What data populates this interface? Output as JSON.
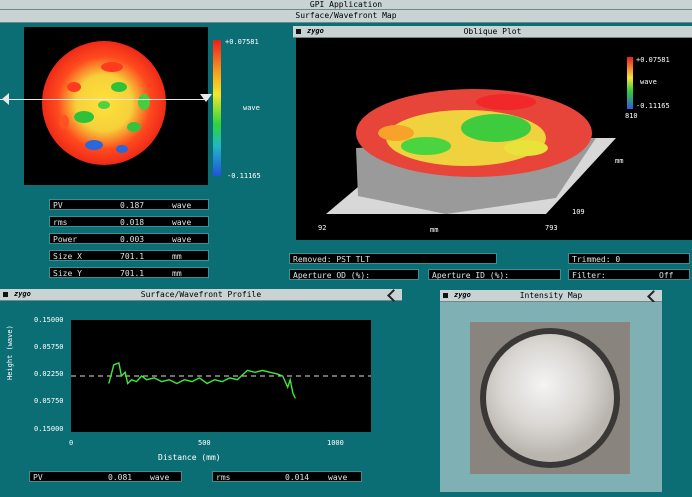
{
  "app": {
    "title": "GPI Application",
    "subtitle": "Surface/Wavefront Map"
  },
  "map": {
    "colorbar_max": "+0.07581",
    "colorbar_min": "-0.11165",
    "colorbar_unit": "wave"
  },
  "oblique": {
    "logo": "zygo",
    "title": "Oblique Plot",
    "colorbar_max": "+0.07581",
    "colorbar_unit": "wave",
    "colorbar_min": "-0.11165",
    "z_tick": "810",
    "x_start": "92",
    "x_unit": "mm",
    "x_end": "793",
    "y_unit": "mm",
    "y_start": "109"
  },
  "stats": [
    {
      "label": "PV",
      "value": "0.187",
      "unit": "wave"
    },
    {
      "label": "rms",
      "value": "0.018",
      "unit": "wave"
    },
    {
      "label": "Power",
      "value": "0.003",
      "unit": "wave"
    },
    {
      "label": "Size X",
      "value": "701.1",
      "unit": "mm"
    },
    {
      "label": "Size Y",
      "value": "701.1",
      "unit": "mm"
    }
  ],
  "status": {
    "removed": "Removed: PST TLT",
    "trimmed": "Trimmed: 0",
    "aperture_od": "Aperture OD (%):",
    "aperture_id": "Aperture ID (%):",
    "filter": "Filter:",
    "filter_value": "Off"
  },
  "profile": {
    "logo": "zygo",
    "title": "Surface/Wavefront Profile",
    "ylabel": "Height (wave)",
    "xlabel": "Distance (mm)",
    "yticks": [
      "0.15000",
      "0.05750",
      "0.02250",
      "0.05750",
      "0.15000"
    ],
    "xticks": [
      "0",
      "500",
      "1000"
    ],
    "pv_label": "PV",
    "pv_value": "0.081",
    "pv_unit": "wave",
    "rms_label": "rms",
    "rms_value": "0.014",
    "rms_unit": "wave"
  },
  "intensity": {
    "logo": "zygo",
    "title": "Intensity Map"
  },
  "colors": {
    "background": "#0b6e74",
    "titlebar": "#c9d3d4",
    "trace": "#41e83a"
  },
  "chart_data": {
    "type": "line",
    "xlabel": "Distance (mm)",
    "ylabel": "Height (wave)",
    "xlim": [
      0,
      1000
    ],
    "ylim": [
      -0.15,
      0.15
    ],
    "series": [
      {
        "x": [
          150,
          170,
          190,
          200,
          215,
          225,
          240,
          260,
          280,
          300,
          330,
          360,
          390,
          420,
          450,
          480,
          510,
          540,
          570,
          600,
          630,
          660,
          700,
          730,
          760,
          790,
          820,
          840,
          860,
          870,
          880,
          890
        ],
        "values": [
          -0.02,
          0.03,
          0.035,
          0.0,
          0.01,
          -0.02,
          -0.01,
          -0.015,
          0.0,
          -0.01,
          -0.005,
          -0.015,
          -0.01,
          -0.02,
          -0.01,
          -0.015,
          -0.005,
          -0.02,
          -0.01,
          -0.015,
          -0.005,
          -0.01,
          0.015,
          0.01,
          0.015,
          0.01,
          0.005,
          0.0,
          -0.03,
          -0.01,
          -0.045,
          -0.06
        ]
      }
    ]
  }
}
